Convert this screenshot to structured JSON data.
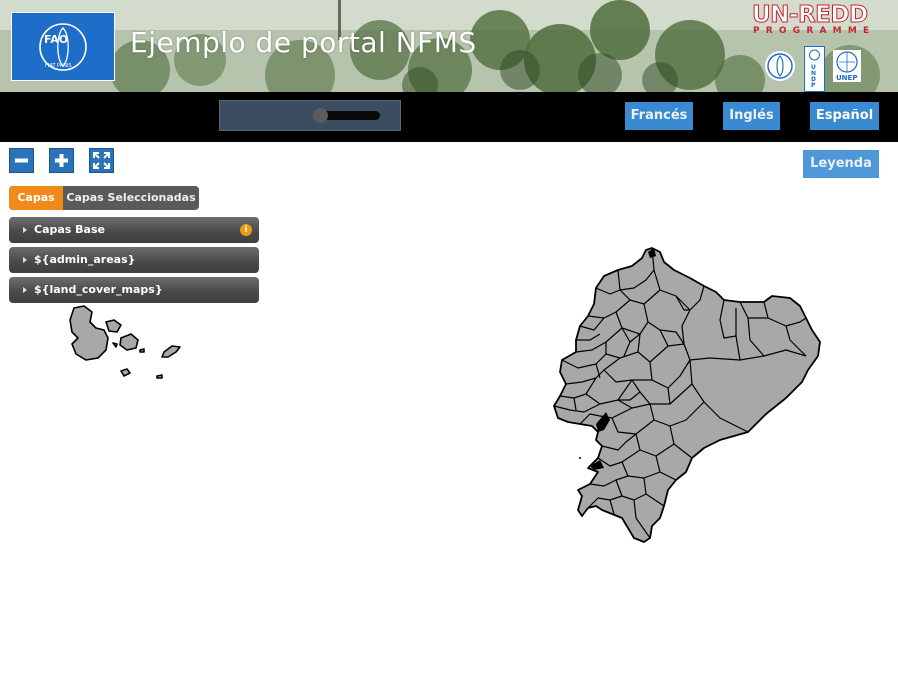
{
  "header": {
    "title": "Ejemplo de portal NFMS",
    "fao_logo_text": "FIAT PANIS",
    "fao_letters": "FAO",
    "unredd_logo": "UN-REDD",
    "programme_text": "PROGRAMME",
    "partner_logos": [
      "fao-emblem",
      "undp-logo",
      "unep-logo"
    ],
    "undp_letters": "UNDP",
    "unep_letters": "UNEP"
  },
  "toolbar": {
    "languages": [
      {
        "label": "Francés",
        "active": false
      },
      {
        "label": "Inglés",
        "active": false
      },
      {
        "label": "Español",
        "active": true
      }
    ]
  },
  "map_controls": {
    "zoom_out_icon": "minus-icon",
    "zoom_in_icon": "plus-icon",
    "full_extent_icon": "expand-icon",
    "legend_label": "Leyenda"
  },
  "layers_panel": {
    "tabs": [
      {
        "label": "Capas",
        "active": true
      },
      {
        "label": "Capas Seleccionadas",
        "active": false
      }
    ],
    "groups": [
      {
        "label": "Capas Base",
        "info_icon": "info-icon"
      },
      {
        "label": "${admin_areas}"
      },
      {
        "label": "${land_cover_maps}"
      }
    ]
  },
  "colors": {
    "header_blue": "#1e6dc8",
    "lang_button": "#3a8ad1",
    "legend_button": "#4f98d8",
    "active_tab": "#f08a1a",
    "map_fill": "#a8a8a8",
    "map_stroke": "#000000"
  }
}
